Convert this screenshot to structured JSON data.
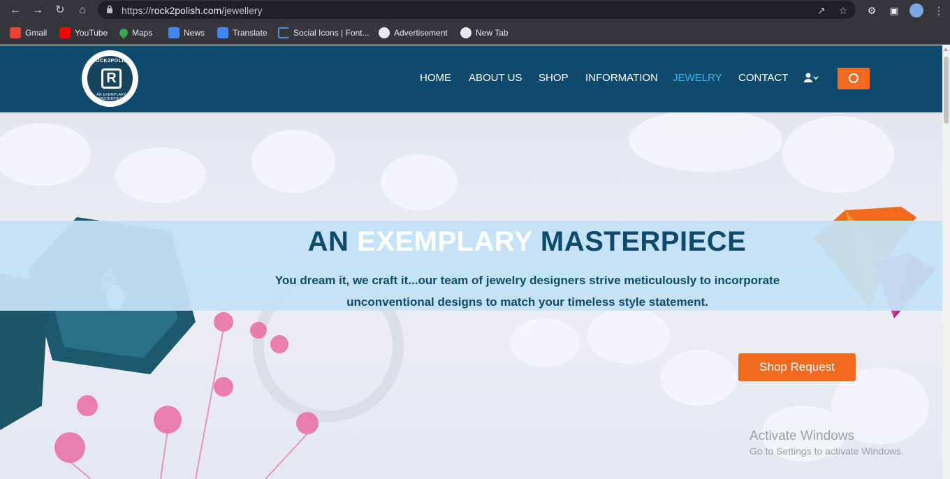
{
  "browser": {
    "url_scheme": "https://",
    "url_host": "rock2polish.com",
    "url_path": "/jewellery",
    "bookmarks": [
      {
        "label": "Gmail",
        "icon": "gmail-icon",
        "color": "#ea4335"
      },
      {
        "label": "YouTube",
        "icon": "youtube-icon",
        "color": "#ff0000"
      },
      {
        "label": "Maps",
        "icon": "maps-icon",
        "color": "#34a853"
      },
      {
        "label": "News",
        "icon": "news-icon",
        "color": "#4285f4"
      },
      {
        "label": "Translate",
        "icon": "translate-icon",
        "color": "#4285f4"
      },
      {
        "label": "Social Icons | Font...",
        "icon": "flag-icon",
        "color": "#4a90e2"
      },
      {
        "label": "Advertisement",
        "icon": "globe-icon",
        "color": "#e8eaed"
      },
      {
        "label": "New Tab",
        "icon": "globe-icon",
        "color": "#e8eaed"
      }
    ]
  },
  "site": {
    "logo_top": "ROCK2POLISH",
    "logo_bottom": "AN EXEMPLARY MASTERPIECE",
    "logo_mark": "R",
    "nav": [
      {
        "label": "HOME",
        "active": false
      },
      {
        "label": "ABOUT US",
        "active": false
      },
      {
        "label": "SHOP",
        "active": false
      },
      {
        "label": "INFORMATION",
        "active": false
      },
      {
        "label": "JEWELRY",
        "active": true
      },
      {
        "label": "CONTACT",
        "active": false
      }
    ],
    "colors": {
      "header_bg": "#0d4a6b",
      "accent": "#f26a1e",
      "active_link": "#35b7e8",
      "band": "#c3e1f5"
    }
  },
  "hero": {
    "title_part1": "AN",
    "title_highlight": "EXEMPLARY",
    "title_part2": "MASTERPIECE",
    "subtitle_line1": "You dream it, we craft it...our team of jewelry designers strive meticulously to incorporate",
    "subtitle_line2": "unconventional designs to match your timeless style statement.",
    "cta_label": "Shop Request"
  },
  "os_watermark": {
    "line1": "Activate Windows",
    "line2": "Go to Settings to activate Windows."
  }
}
